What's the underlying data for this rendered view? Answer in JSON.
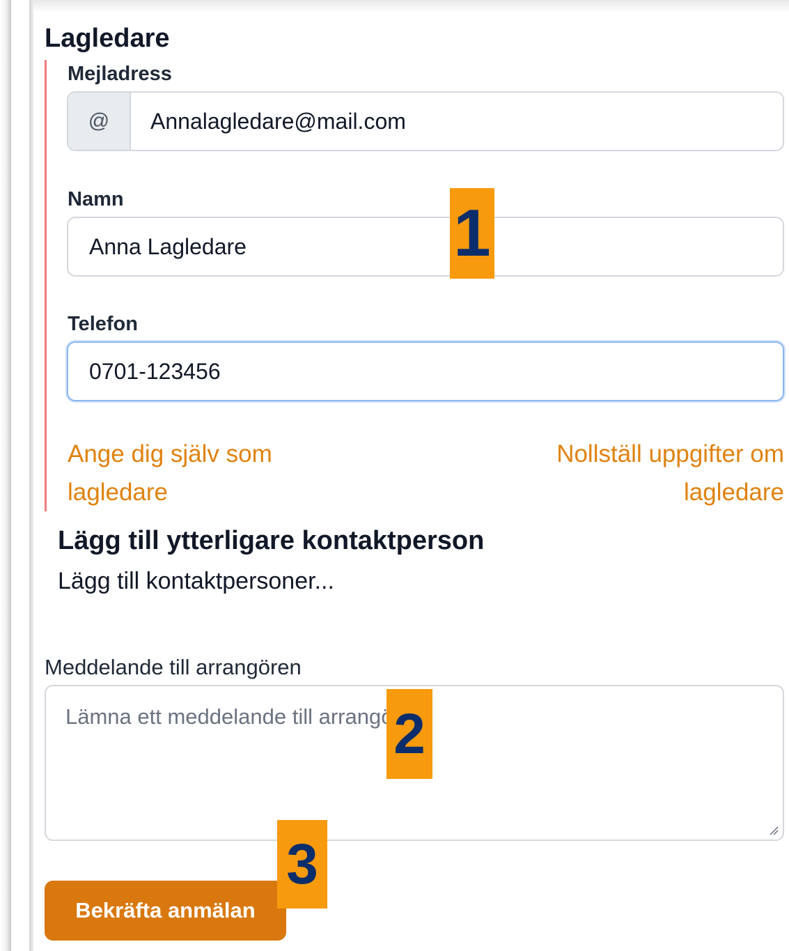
{
  "section": {
    "title": "Lagledare"
  },
  "email": {
    "label": "Mejladress",
    "addon": "@",
    "value": "Annalagledare@mail.com"
  },
  "name": {
    "label": "Namn",
    "value": "Anna Lagledare"
  },
  "phone": {
    "label": "Telefon",
    "value": "0701-123456"
  },
  "links": {
    "set_self_line1": "Ange dig själv som",
    "set_self_line2": "lagledare",
    "reset_line1": "Nollställ uppgifter om",
    "reset_line2": "lagledare"
  },
  "contacts": {
    "title": "Lägg till ytterligare kontaktperson",
    "subtitle": "Lägg till kontaktpersoner..."
  },
  "message": {
    "label": "Meddelande till arrangören",
    "placeholder": "Lämna ett meddelande till arrangören"
  },
  "submit": {
    "label": "Bekräfta anmälan"
  },
  "markers": [
    "1",
    "2",
    "3"
  ],
  "colors": {
    "accent_orange": "#d9780f",
    "link_orange": "#e0820f",
    "marker_bg": "#f79a0d",
    "marker_text": "#0c2d6b",
    "section_bar": "#ef7b7b"
  }
}
